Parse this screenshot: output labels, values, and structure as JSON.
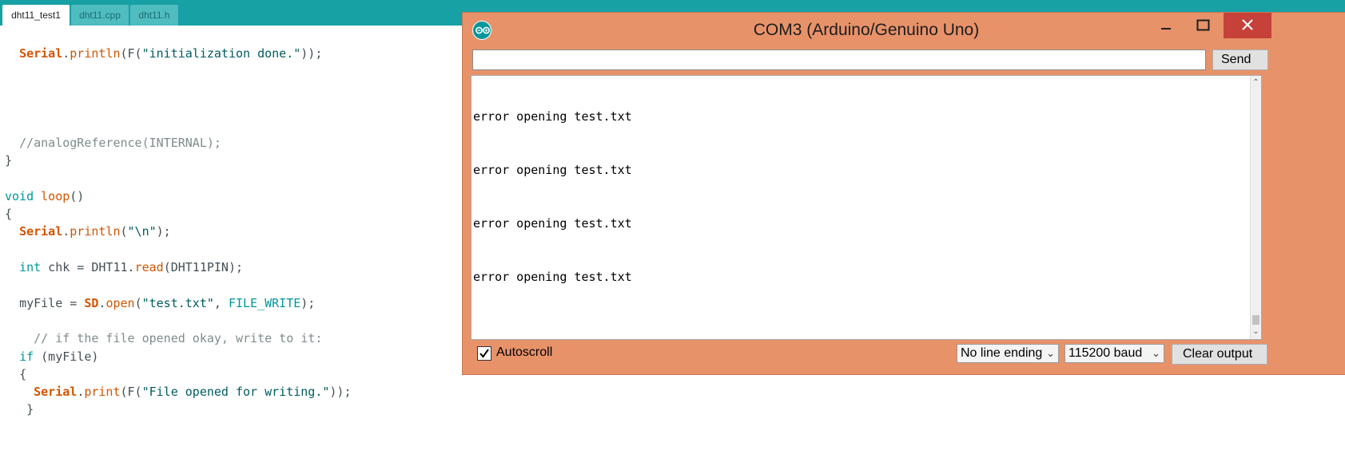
{
  "ide": {
    "tabs": [
      {
        "label": "dht11_test1",
        "active": true
      },
      {
        "label": "dht11.cpp",
        "active": false
      },
      {
        "label": "dht11.h",
        "active": false
      }
    ],
    "colors": {
      "tabbar": "#17a1a5",
      "keyword": "#00979c",
      "function": "#d35400",
      "comment": "#7f8c8d"
    }
  },
  "code": {
    "l1": {
      "obj": "Serial",
      "dot": ".",
      "fn": "println",
      "pre": "(F(",
      "str": "\"initialization done.\"",
      "post": "));"
    },
    "l2": {
      "comment": "//analogReference(INTERNAL);"
    },
    "l3": {
      "text": "}"
    },
    "l4": {
      "kw": "void",
      "fn": "loop",
      "post": "()"
    },
    "l5": {
      "text": "{"
    },
    "l6": {
      "obj": "Serial",
      "dot": ".",
      "fn": "println",
      "pre": "(",
      "str": "\"\\n\"",
      "post": ");"
    },
    "l7": {
      "kw": "int",
      "mid": " chk = DHT11.",
      "fn": "read",
      "post": "(DHT11PIN);"
    },
    "l8": {
      "pre": "myFile = ",
      "obj": "SD",
      "dot": ".",
      "fn": "open",
      "mid": "(",
      "str": "\"test.txt\"",
      "sep": ", ",
      "kw": "FILE_WRITE",
      "post": ");"
    },
    "l9": {
      "comment": "// if the file opened okay, write to it:"
    },
    "l10": {
      "kw": "if",
      "post": " (myFile)"
    },
    "l11": {
      "text": "{"
    },
    "l12": {
      "obj": "Serial",
      "dot": ".",
      "fn": "print",
      "pre": "(F(",
      "str": "\"File opened for writing.\"",
      "post": "));"
    },
    "l13": {
      "text": "}"
    }
  },
  "serial_monitor": {
    "title": "COM3 (Arduino/Genuino Uno)",
    "input_value": "",
    "send_label": "Send",
    "output_lines": [
      "error opening test.txt",
      "error opening test.txt",
      "error opening test.txt",
      "error opening test.txt"
    ],
    "autoscroll_label": "Autoscroll",
    "autoscroll_checked": true,
    "line_ending": "No line ending",
    "baud": "115200 baud",
    "clear_label": "Clear output",
    "colors": {
      "frame": "#e8926a",
      "close": "#c7413b"
    }
  }
}
